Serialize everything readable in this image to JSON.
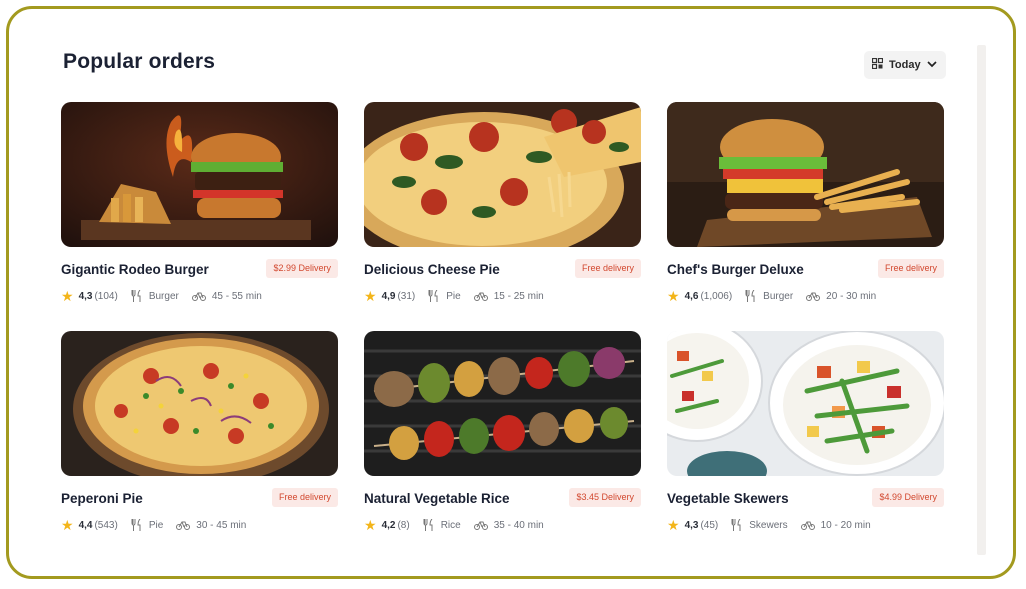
{
  "header": {
    "title": "Popular orders",
    "filter_label": "Today"
  },
  "cards": [
    {
      "name": "Gigantic Rodeo Burger",
      "badge": "$2.99 Delivery",
      "rating": "4,3",
      "reviews": "(104)",
      "category": "Burger",
      "time": "45 - 55 min"
    },
    {
      "name": "Delicious Cheese Pie",
      "badge": "Free delivery",
      "rating": "4,9",
      "reviews": "(31)",
      "category": "Pie",
      "time": "15 - 25 min"
    },
    {
      "name": "Chef's Burger Deluxe",
      "badge": "Free delivery",
      "rating": "4,6",
      "reviews": "(1,006)",
      "category": "Burger",
      "time": "20 - 30 min"
    },
    {
      "name": "Peperoni Pie",
      "badge": "Free delivery",
      "rating": "4,4",
      "reviews": "(543)",
      "category": "Pie",
      "time": "30 - 45 min"
    },
    {
      "name": "Natural Vegetable Rice",
      "badge": "$3.45 Delivery",
      "rating": "4,2",
      "reviews": "(8)",
      "category": "Rice",
      "time": "35 - 40 min"
    },
    {
      "name": "Vegetable Skewers",
      "badge": "$4.99 Delivery",
      "rating": "4,3",
      "reviews": "(45)",
      "category": "Skewers",
      "time": "10 - 20 min"
    }
  ],
  "colors": {
    "frame": "#a39a1f",
    "badge_bg": "#fbe9e6",
    "badge_text": "#d2482f",
    "star": "#f3b51a",
    "title": "#1b2133"
  },
  "icons": {
    "filter": "grid-icon",
    "dropdown": "chevron-down-icon",
    "rating": "star-icon",
    "category": "fork-knife-icon",
    "delivery_time": "bicycle-icon"
  }
}
